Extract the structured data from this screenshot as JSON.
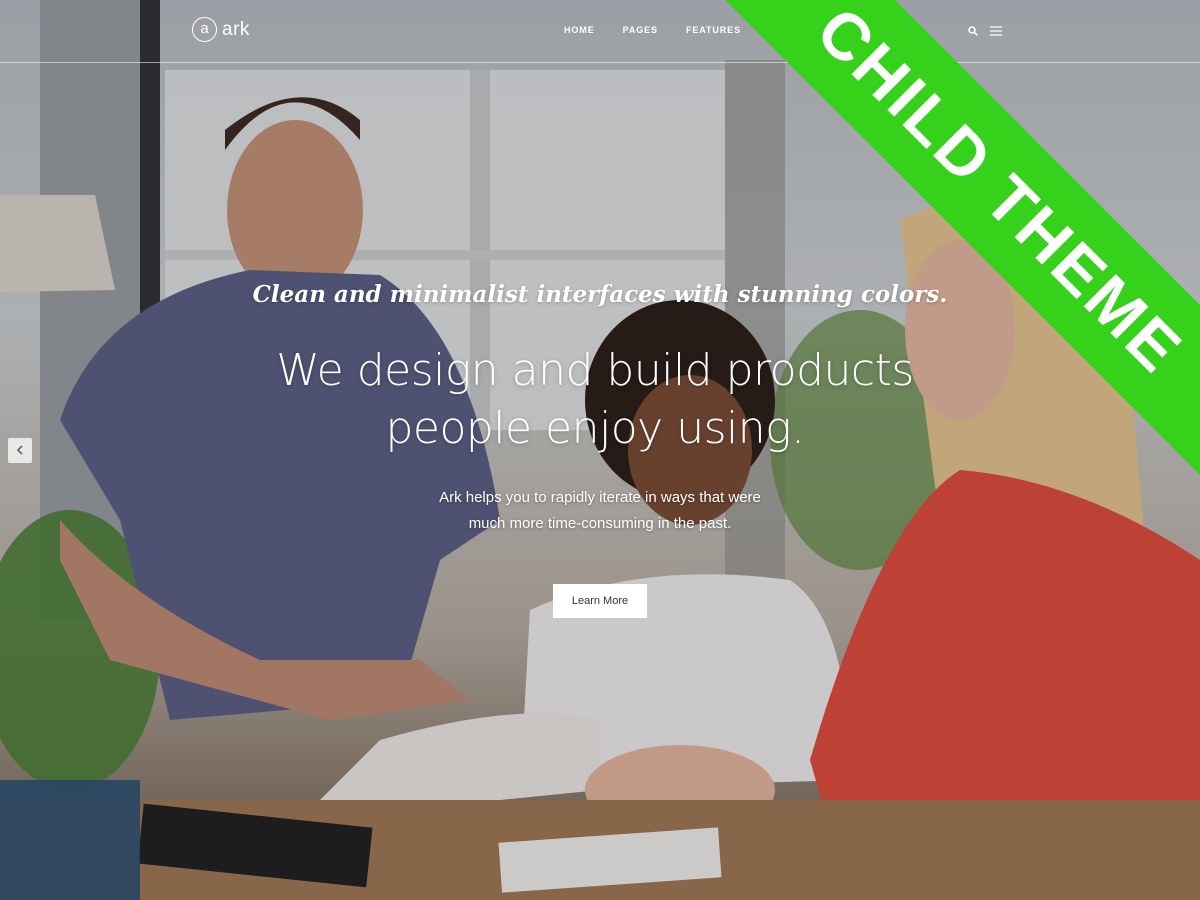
{
  "header": {
    "logo_mark": "a",
    "logo_text": "ark",
    "nav": [
      "HOME",
      "PAGES",
      "FEATURES"
    ]
  },
  "hero": {
    "tagline": "Clean and minimalist interfaces with stunning colors.",
    "headline_line1": "We design and build products",
    "headline_line2": "people enjoy using.",
    "subtext_line1": "Ark helps you to rapidly iterate in ways that were",
    "subtext_line2": "much more time-consuming in the past.",
    "cta_label": "Learn More"
  },
  "banner": {
    "text": "CHILD THEME",
    "color": "#35d11b"
  },
  "icons": {
    "search": "search-icon",
    "menu": "hamburger-menu-icon",
    "prev": "chevron-left-icon"
  }
}
